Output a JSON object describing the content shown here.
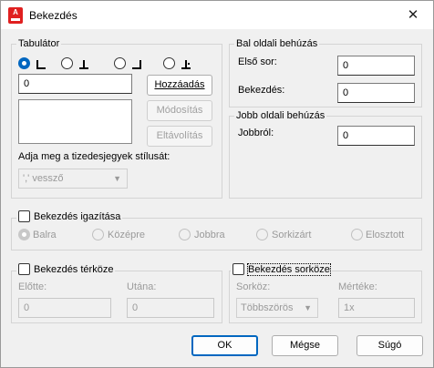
{
  "window": {
    "title": "Bekezdés",
    "close_glyph": "✕",
    "app_icon": "autocad-icon",
    "app_icon_letter": "A"
  },
  "tabulator": {
    "group_label": "Tabulátor",
    "selected_tab": "left",
    "tab_types": [
      "left",
      "center",
      "right",
      "decimal"
    ],
    "position_value": "0",
    "add_button": "Hozzáadás",
    "modify_button": "Módosítás",
    "remove_button": "Eltávolítás",
    "decimal_style_label": "Adja meg a tizedesjegyek stílusát:",
    "decimal_style_value": "',' vessző"
  },
  "left_indent": {
    "group_label": "Bal oldali behúzás",
    "first_line_label": "Első sor:",
    "first_line_value": "0",
    "paragraph_label": "Bekezdés:",
    "paragraph_value": "0"
  },
  "right_indent": {
    "group_label": "Jobb oldali behúzás",
    "right_label": "Jobbról:",
    "right_value": "0"
  },
  "alignment": {
    "checkbox_label": "Bekezdés igazítása",
    "checked": false,
    "selected": "left",
    "options": [
      "Balra",
      "Középre",
      "Jobbra",
      "Sorkizárt",
      "Elosztott"
    ]
  },
  "spacing": {
    "checkbox_label": "Bekezdés térköze",
    "checked": false,
    "before_label": "Előtte:",
    "before_value": "0",
    "after_label": "Utána:",
    "after_value": "0"
  },
  "line_spacing": {
    "checkbox_label": "Bekezdés sorköze",
    "checked": false,
    "spacing_label": "Sorköz:",
    "spacing_value": "Többszörös",
    "amount_label": "Mértéke:",
    "amount_value": "1x"
  },
  "footer": {
    "ok": "OK",
    "cancel": "Mégse",
    "help": "Súgó"
  }
}
